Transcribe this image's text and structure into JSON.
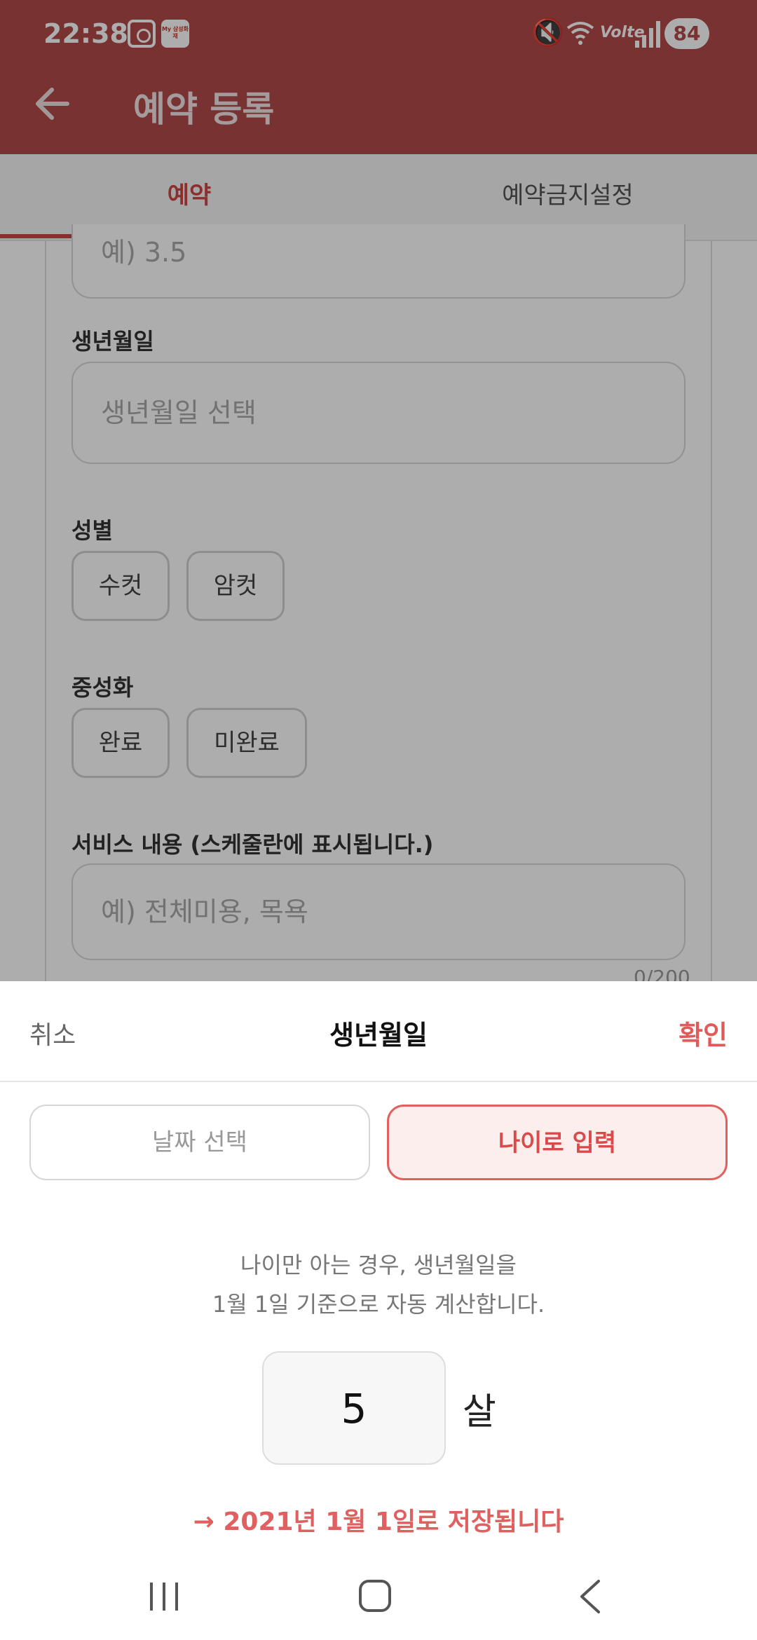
{
  "status_bar": {
    "time": "22:38",
    "app_badge": "My 삼성화재",
    "battery": "84",
    "network": "Volte"
  },
  "app_bar": {
    "title": "예약 등록"
  },
  "tabs": [
    {
      "label": "예약",
      "active": true
    },
    {
      "label": "예약금지설정",
      "active": false
    }
  ],
  "form": {
    "weight_placeholder": "예) 3.5",
    "birthdate_label": "생년월일",
    "birthdate_placeholder": "생년월일 선택",
    "sex_label": "성별",
    "sex_options": [
      "수컷",
      "암컷"
    ],
    "neuter_label": "중성화",
    "neuter_options": [
      "완료",
      "미완료"
    ],
    "service_label": "서비스 내용 (스케줄란에 표시됩니다.)",
    "service_placeholder": "예) 전체미용, 목욕",
    "service_counter": "0/200"
  },
  "sheet": {
    "cancel": "취소",
    "title": "생년월일",
    "confirm": "확인",
    "mode_options": [
      "날짜 선택",
      "나이로 입력"
    ],
    "selected_mode": "나이로 입력",
    "desc_line1": "나이만 아는 경우, 생년월일을",
    "desc_line2": "1월 1일 기준으로 자동 계산합니다.",
    "age_value": "5",
    "age_unit": "살",
    "result": "→ 2021년 1월 1일로 저장됩니다"
  },
  "colors": {
    "brand": "#b34b4b",
    "accent": "#e05a5a"
  }
}
